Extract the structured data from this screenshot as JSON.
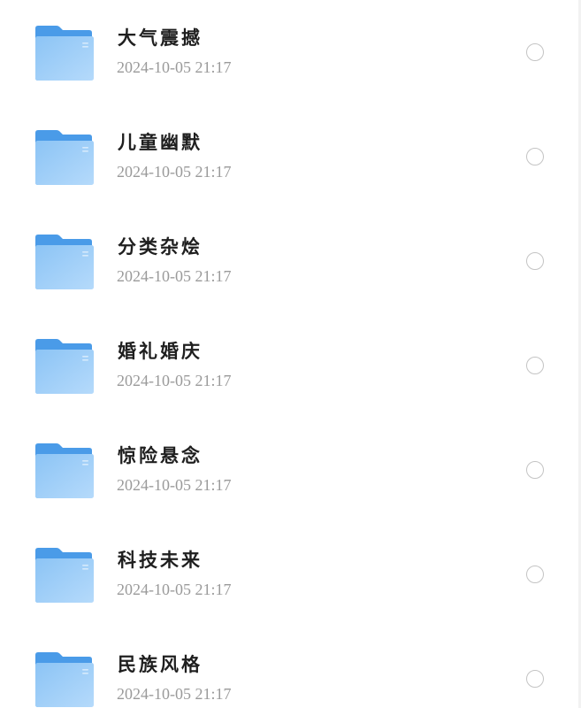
{
  "colors": {
    "folder_back": "#4a9be8",
    "folder_front_top": "#8cc4f5",
    "folder_front_bottom": "#b5dafb",
    "name_text": "#1f1f1f",
    "time_text": "#9a9a9a",
    "radio_border": "#c4c4c4"
  },
  "folders": [
    {
      "name": "大气震撼",
      "modified": "2024-10-05 21:17",
      "icon": "folder-icon",
      "selected": false
    },
    {
      "name": "儿童幽默",
      "modified": "2024-10-05 21:17",
      "icon": "folder-icon",
      "selected": false
    },
    {
      "name": "分类杂烩",
      "modified": "2024-10-05 21:17",
      "icon": "folder-icon",
      "selected": false
    },
    {
      "name": "婚礼婚庆",
      "modified": "2024-10-05 21:17",
      "icon": "folder-icon",
      "selected": false
    },
    {
      "name": "惊险悬念",
      "modified": "2024-10-05 21:17",
      "icon": "folder-icon",
      "selected": false
    },
    {
      "name": "科技未来",
      "modified": "2024-10-05 21:17",
      "icon": "folder-icon",
      "selected": false
    },
    {
      "name": "民族风格",
      "modified": "2024-10-05 21:17",
      "icon": "folder-icon",
      "selected": false
    }
  ]
}
